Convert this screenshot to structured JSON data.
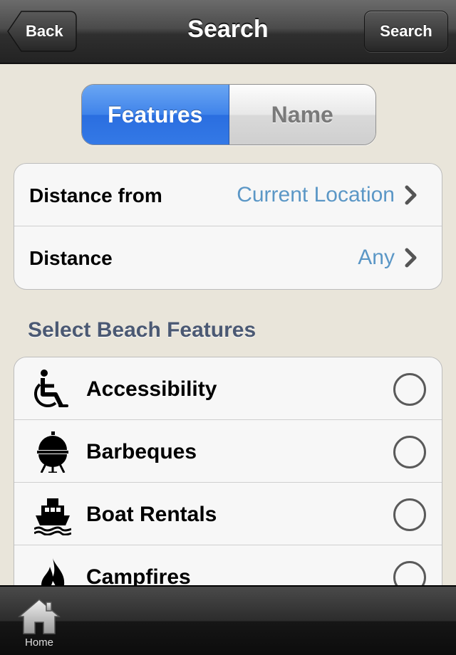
{
  "navbar": {
    "title": "Search",
    "back_label": "Back",
    "right_label": "Search"
  },
  "segmented": {
    "options": [
      {
        "label": "Features",
        "selected": true
      },
      {
        "label": "Name",
        "selected": false
      }
    ]
  },
  "filters": [
    {
      "label": "Distance from",
      "value": "Current Location"
    },
    {
      "label": "Distance",
      "value": "Any"
    }
  ],
  "features_section": {
    "header": "Select Beach Features",
    "items": [
      {
        "label": "Accessibility",
        "icon": "wheelchair-icon",
        "checked": false
      },
      {
        "label": "Barbeques",
        "icon": "grill-icon",
        "checked": false
      },
      {
        "label": "Boat Rentals",
        "icon": "boat-icon",
        "checked": false
      },
      {
        "label": "Campfires",
        "icon": "fire-icon",
        "checked": false
      }
    ]
  },
  "tabbar": {
    "items": [
      {
        "label": "Home",
        "icon": "home-icon"
      }
    ]
  },
  "colors": {
    "accent": "#3f83ea",
    "value_text": "#5b97c6",
    "background": "#e9e5da",
    "section_header": "#4b5973"
  }
}
